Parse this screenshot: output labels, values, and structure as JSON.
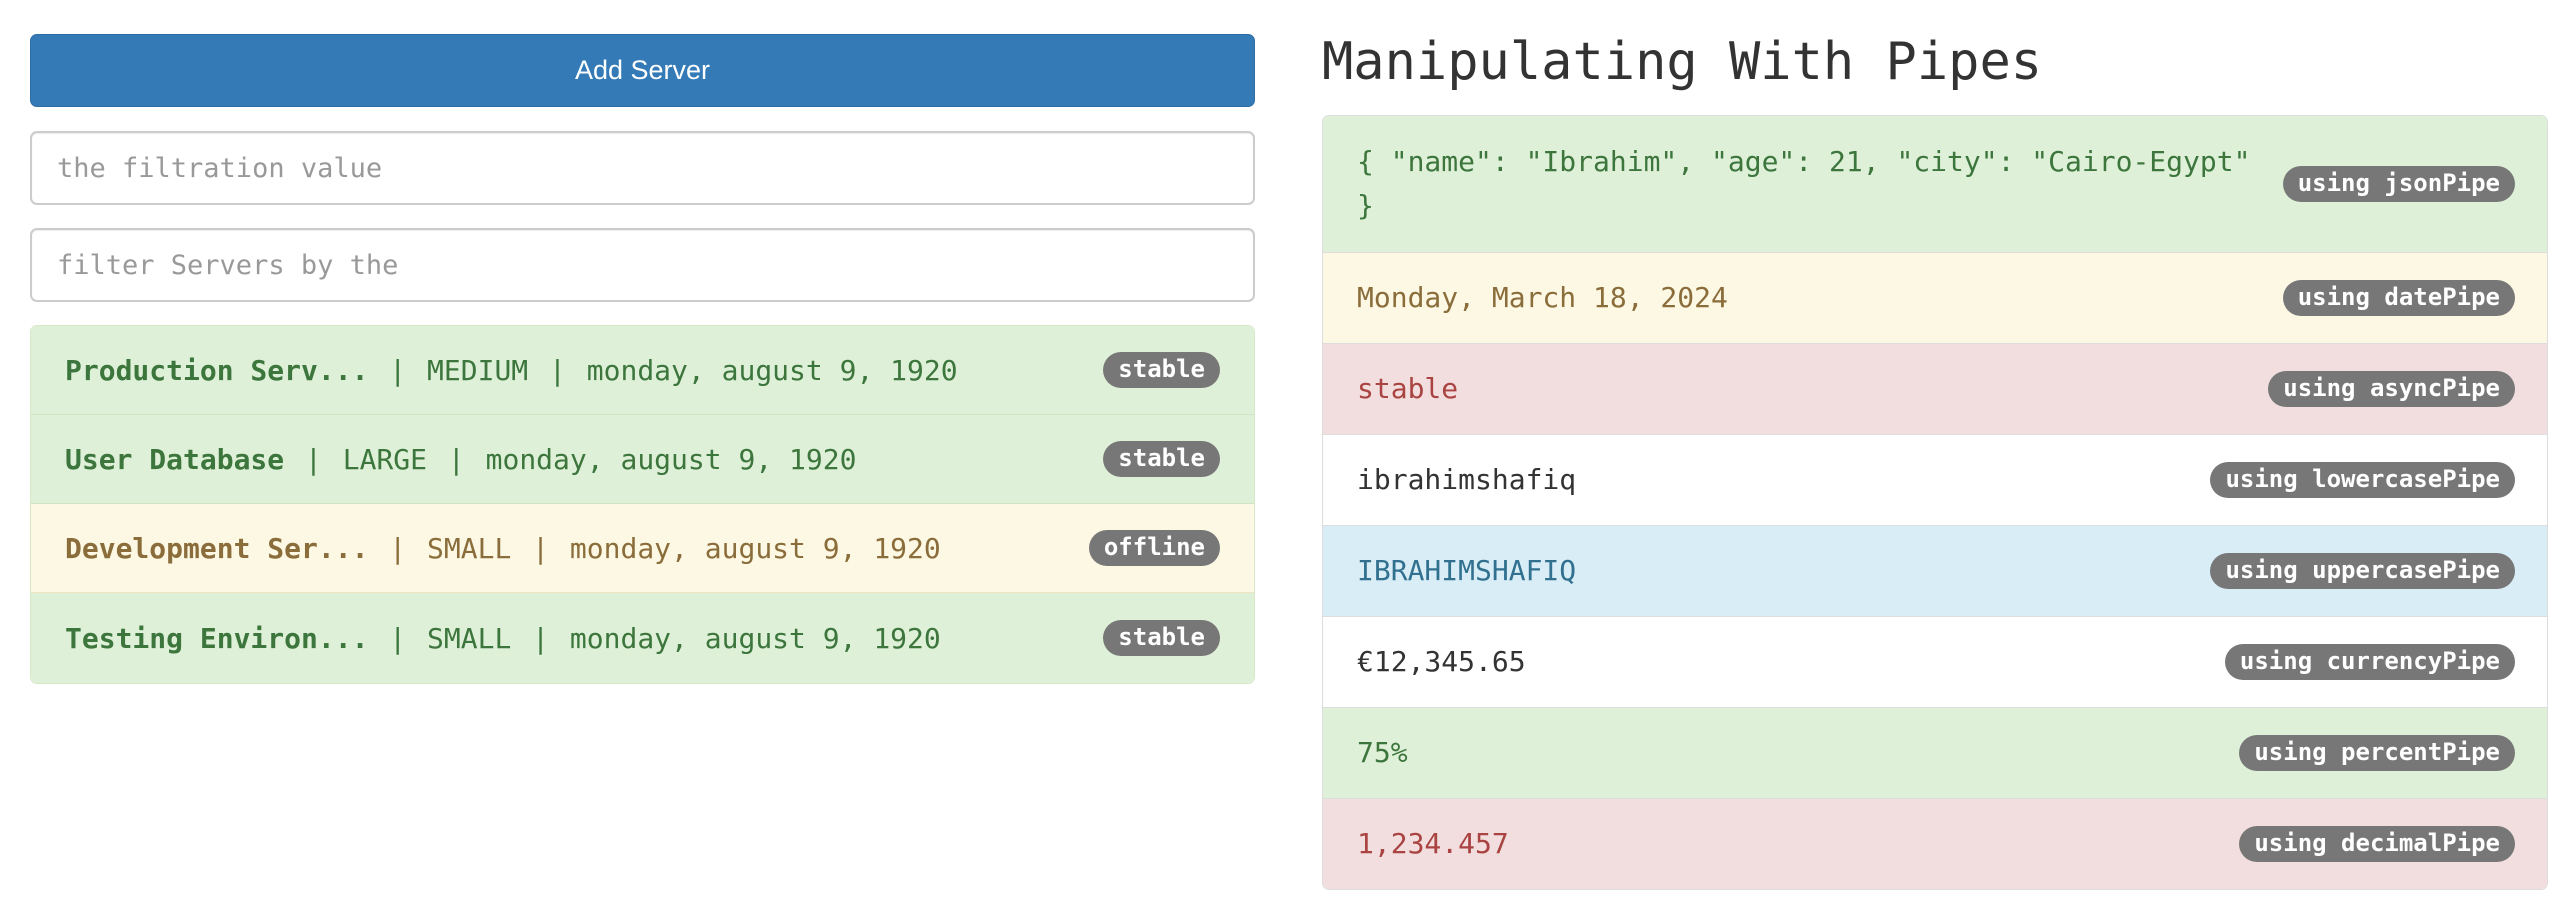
{
  "left": {
    "add_button_label": "Add Server",
    "filter_input_1_placeholder": "the filtration value",
    "filter_input_2_placeholder": "filter Servers by the",
    "servers": [
      {
        "name": "Production Serv...",
        "size": "MEDIUM",
        "date": "monday, august 9, 1920",
        "status": "stable"
      },
      {
        "name": "User Database",
        "size": "LARGE",
        "date": "monday, august 9, 1920",
        "status": "stable"
      },
      {
        "name": "Development Ser...",
        "size": "SMALL",
        "date": "monday, august 9, 1920",
        "status": "offline"
      },
      {
        "name": "Testing Environ...",
        "size": "SMALL",
        "date": "monday, august 9, 1920",
        "status": "stable"
      }
    ],
    "separator": "|"
  },
  "right": {
    "title": "Manipulating With Pipes",
    "pipes": [
      {
        "value": "{ \"name\": \"Ibrahim\", \"age\": 21, \"city\": \"Cairo-Egypt\" }",
        "badge": "using jsonPipe"
      },
      {
        "value": "Monday, March 18, 2024",
        "badge": "using datePipe"
      },
      {
        "value": "stable",
        "badge": "using asyncPipe"
      },
      {
        "value": "ibrahimshafiq",
        "badge": "using lowercasePipe"
      },
      {
        "value": "IBRAHIMSHAFIQ",
        "badge": "using uppercasePipe"
      },
      {
        "value": "€12,345.65",
        "badge": "using currencyPipe"
      },
      {
        "value": "75%",
        "badge": "using percentPipe"
      },
      {
        "value": "1,234.457",
        "badge": "using decimalPipe"
      }
    ]
  },
  "colors": {
    "primary": "#337ab7",
    "success_bg": "#dff0d8",
    "success_text": "#3c763d",
    "warning_bg": "#fcf8e3",
    "warning_text": "#8a6d3b",
    "danger_bg": "#f2dede",
    "danger_text": "#a94442",
    "info_bg": "#d9edf7",
    "info_text": "#31708f",
    "badge_bg": "#777777"
  }
}
